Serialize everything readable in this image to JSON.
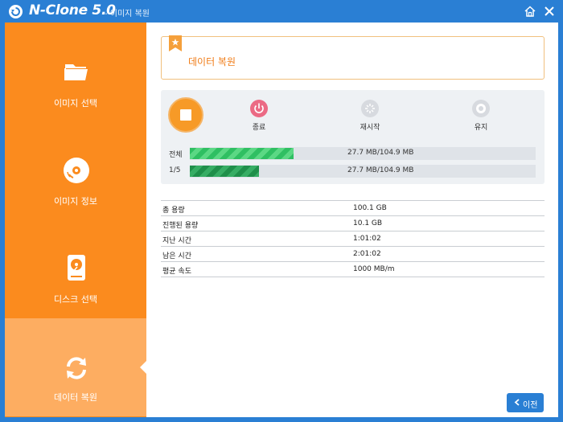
{
  "window": {
    "title": "N-Clone 5.0",
    "subtitle": "- 이미지 복원"
  },
  "colors": {
    "accent": "#fb8b1e",
    "accent_active": "#fdad61",
    "titlebar": "#2a7fd4",
    "progress": "#2fbf62",
    "stop": "#f79a27",
    "end": "#eb6a84"
  },
  "sidebar": {
    "items": [
      {
        "label": "이미지 선택",
        "icon": "folder-icon",
        "active": false
      },
      {
        "label": "이미지 정보",
        "icon": "disc-icon",
        "active": false
      },
      {
        "label": "디스크 선택",
        "icon": "harddisk-icon",
        "active": false
      },
      {
        "label": "데이터 복원",
        "icon": "refresh-icon",
        "active": true
      }
    ]
  },
  "header": {
    "title": "데이터 복원"
  },
  "controls": {
    "end_label": "종료",
    "restart_label": "재시작",
    "keep_label": "유지"
  },
  "progress": [
    {
      "label": "전체",
      "text": "27.7 MB/104.9 MB",
      "fraction": 0.3
    },
    {
      "label": "1/5",
      "text": "27.7 MB/104.9 MB",
      "fraction": 0.2
    }
  ],
  "stats": [
    {
      "key": "총 용량",
      "value": "100.1 GB"
    },
    {
      "key": "진행된 용량",
      "value": "10.1 GB"
    },
    {
      "key": "지난 시간",
      "value": "1:01:02"
    },
    {
      "key": "남은 시간",
      "value": "2:01:02"
    },
    {
      "key": "평균 속도",
      "value": "1000 MB/m"
    }
  ],
  "footer": {
    "prev_label": "이전"
  }
}
